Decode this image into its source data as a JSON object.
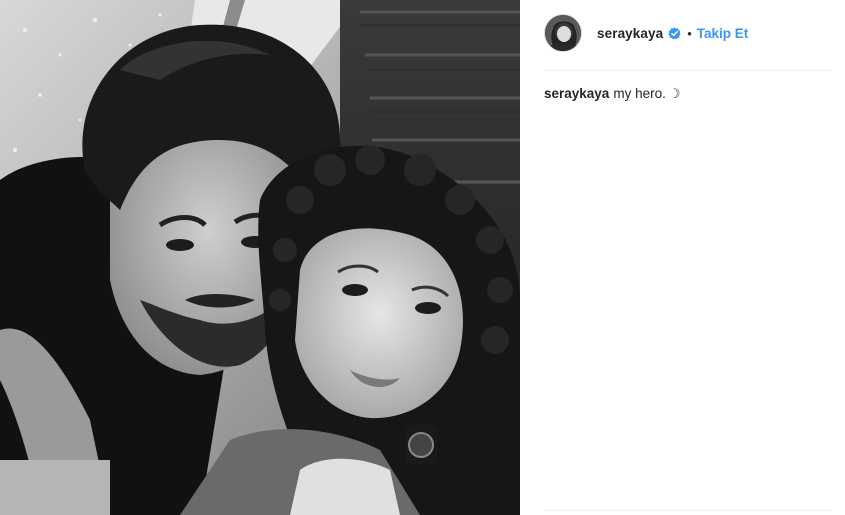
{
  "post": {
    "username": "seraykaya",
    "verified_icon": "verified-badge-icon",
    "separator": "•",
    "follow_label": "Takip Et",
    "caption_user": "seraykaya",
    "caption_text": "my hero.",
    "caption_emoji": "☽",
    "colors": {
      "accent": "#3897f0",
      "text": "#262626",
      "divider": "#efefef"
    }
  }
}
